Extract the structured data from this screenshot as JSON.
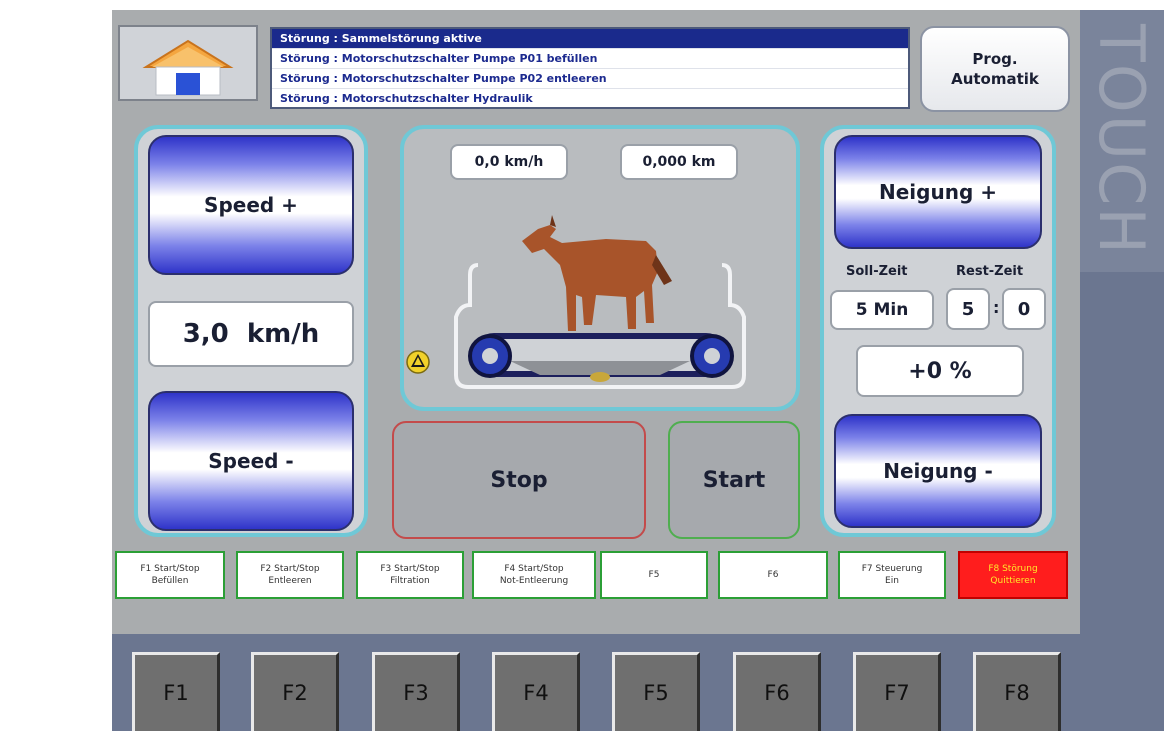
{
  "messages": [
    "Störung : Sammelstörung aktive",
    "Störung : Motorschutzschalter Pumpe P01 befüllen",
    "Störung : Motorschutzschalter Pumpe P02 entleeren",
    "Störung : Motorschutzschalter Hydraulik"
  ],
  "prog_button": {
    "line1": "Prog.",
    "line2": "Automatik"
  },
  "brand": "TOUCH",
  "speed": {
    "plus": "Speed +",
    "minus": "Speed -",
    "value": "3,0  km/h"
  },
  "treadmill": {
    "speed_display": "0,0 km/h",
    "distance_display": "0,000 km",
    "warning_icon": "warning-triangle-icon"
  },
  "incline": {
    "plus": "Neigung +",
    "minus": "Neigung -",
    "soll_label": "Soll-Zeit",
    "rest_label": "Rest-Zeit",
    "soll_value": "5 Min",
    "rest_min": "5",
    "rest_sec": "0",
    "separator": ":",
    "percent": "+0 %"
  },
  "controls": {
    "stop": "Stop",
    "start": "Start"
  },
  "fkey_labels": [
    "F1 Start/Stop\nBefüllen",
    "F2 Start/Stop\nEntleeren",
    "F3 Start/Stop\nFiltration",
    "F4 Start/Stop\nNot-Entleerung",
    "F5",
    "F6",
    "F7 Steuerung\nEin",
    "F8 Störung\nQuittieren"
  ],
  "hardware_keys": [
    "F1",
    "F2",
    "F3",
    "F4",
    "F5",
    "F6",
    "F7",
    "F8"
  ],
  "colors": {
    "accent_frame": "#6fc8d6",
    "alarm": "#ff1d1d",
    "fkey_border": "#2b9f36",
    "selected_message": "#1a2a8c"
  }
}
